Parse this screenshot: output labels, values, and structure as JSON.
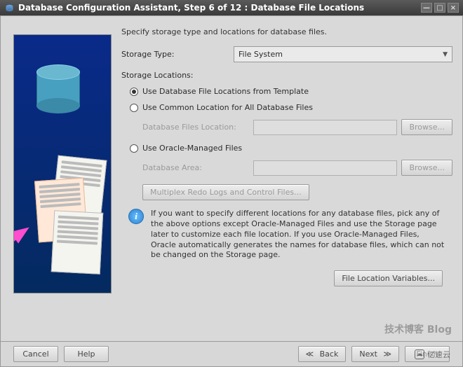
{
  "window": {
    "title": "Database Configuration Assistant, Step 6 of 12 : Database File Locations"
  },
  "form": {
    "intro": "Specify storage type and locations for database files.",
    "storage_type_label": "Storage Type:",
    "storage_type_value": "File System",
    "storage_locations_label": "Storage Locations:",
    "opt_template": "Use Database File Locations from Template",
    "opt_common": "Use Common Location for All Database Files",
    "common_sub_label": "Database Files Location:",
    "common_input": "",
    "browse1": "Browse...",
    "opt_omf": "Use Oracle-Managed Files",
    "omf_sub_label": "Database Area:",
    "omf_input": "",
    "browse2": "Browse...",
    "multiplex_btn": "Multiplex Redo Logs and Control Files...",
    "info_text": "If you want to specify different locations for any database files, pick any of the above options except Oracle-Managed Files and use the Storage page later to customize each file location. If you use Oracle-Managed Files, Oracle automatically generates the names for database files, which can not be changed on the Storage page.",
    "file_loc_vars_btn": "File Location Variables..."
  },
  "footer": {
    "cancel": "Cancel",
    "help": "Help",
    "back": "Back",
    "next": "Next",
    "finish": "Finish"
  },
  "watermark": {
    "main": "技术博客 Blog",
    "site": "亿速云"
  }
}
